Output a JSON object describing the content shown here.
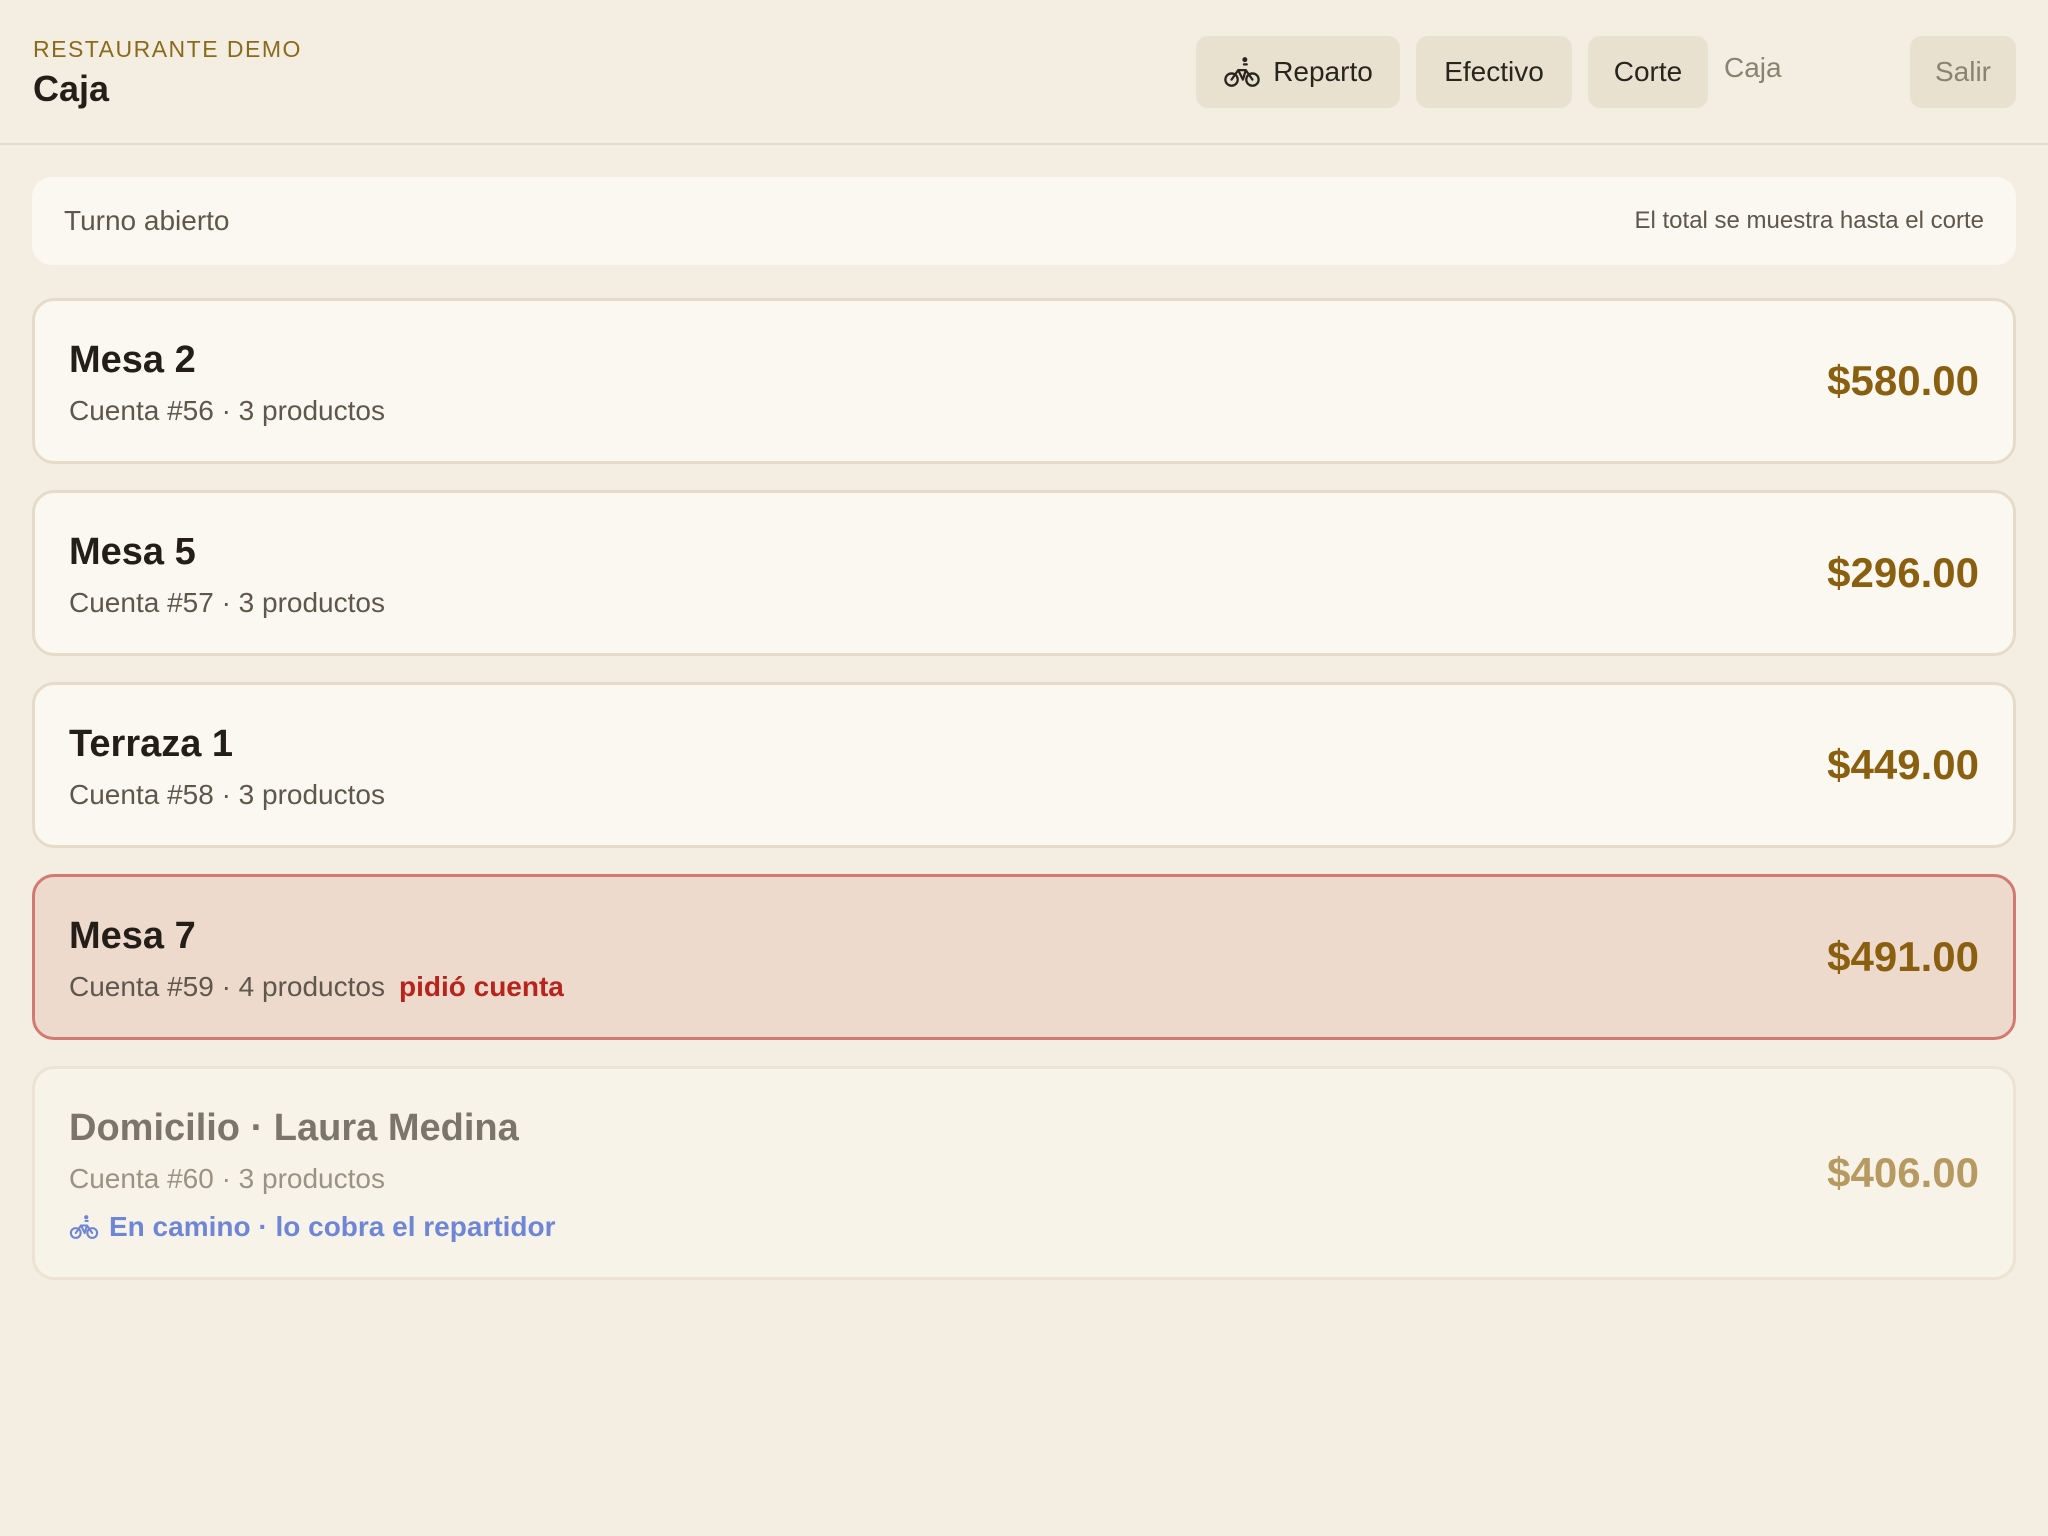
{
  "header": {
    "restaurant_name": "RESTAURANTE DEMO",
    "screen_title": "Caja",
    "buttons": {
      "reparto": {
        "label": "Reparto",
        "icon": "bike-icon"
      },
      "efectivo": {
        "label": "Efectivo"
      },
      "corte": {
        "label": "Corte"
      },
      "salir": {
        "label": "Salir"
      }
    },
    "role_label": "Caja"
  },
  "shift": {
    "status": "Turno abierto",
    "note": "El total se muestra hasta el corte"
  },
  "accounts": [
    {
      "name": "Mesa 2",
      "meta": "Cuenta #56 · 3 productos",
      "total": "$580.00"
    },
    {
      "name": "Mesa 5",
      "meta": "Cuenta #57 · 3 productos",
      "total": "$296.00"
    },
    {
      "name": "Terraza 1",
      "meta": "Cuenta #58 · 3 productos",
      "total": "$449.00"
    },
    {
      "name": "Mesa 7",
      "meta": "Cuenta #59 · 4 productos",
      "tag": "pidió cuenta",
      "total": "$491.00"
    },
    {
      "name": "Domicilio · Laura Medina",
      "meta": "Cuenta #60 · 3 productos",
      "delivery_status": "En camino · lo cobra el repartidor",
      "delivery_icon": "bike-icon",
      "total": "$406.00"
    }
  ],
  "colors": {
    "background": "#f4eee2",
    "card": "#fbf8f1",
    "accent_total": "#8a5f10",
    "alert_border": "#d27a72",
    "alert_background": "#eddacd",
    "alert_text": "#b8231c",
    "delivery_text": "#6f86d6"
  }
}
